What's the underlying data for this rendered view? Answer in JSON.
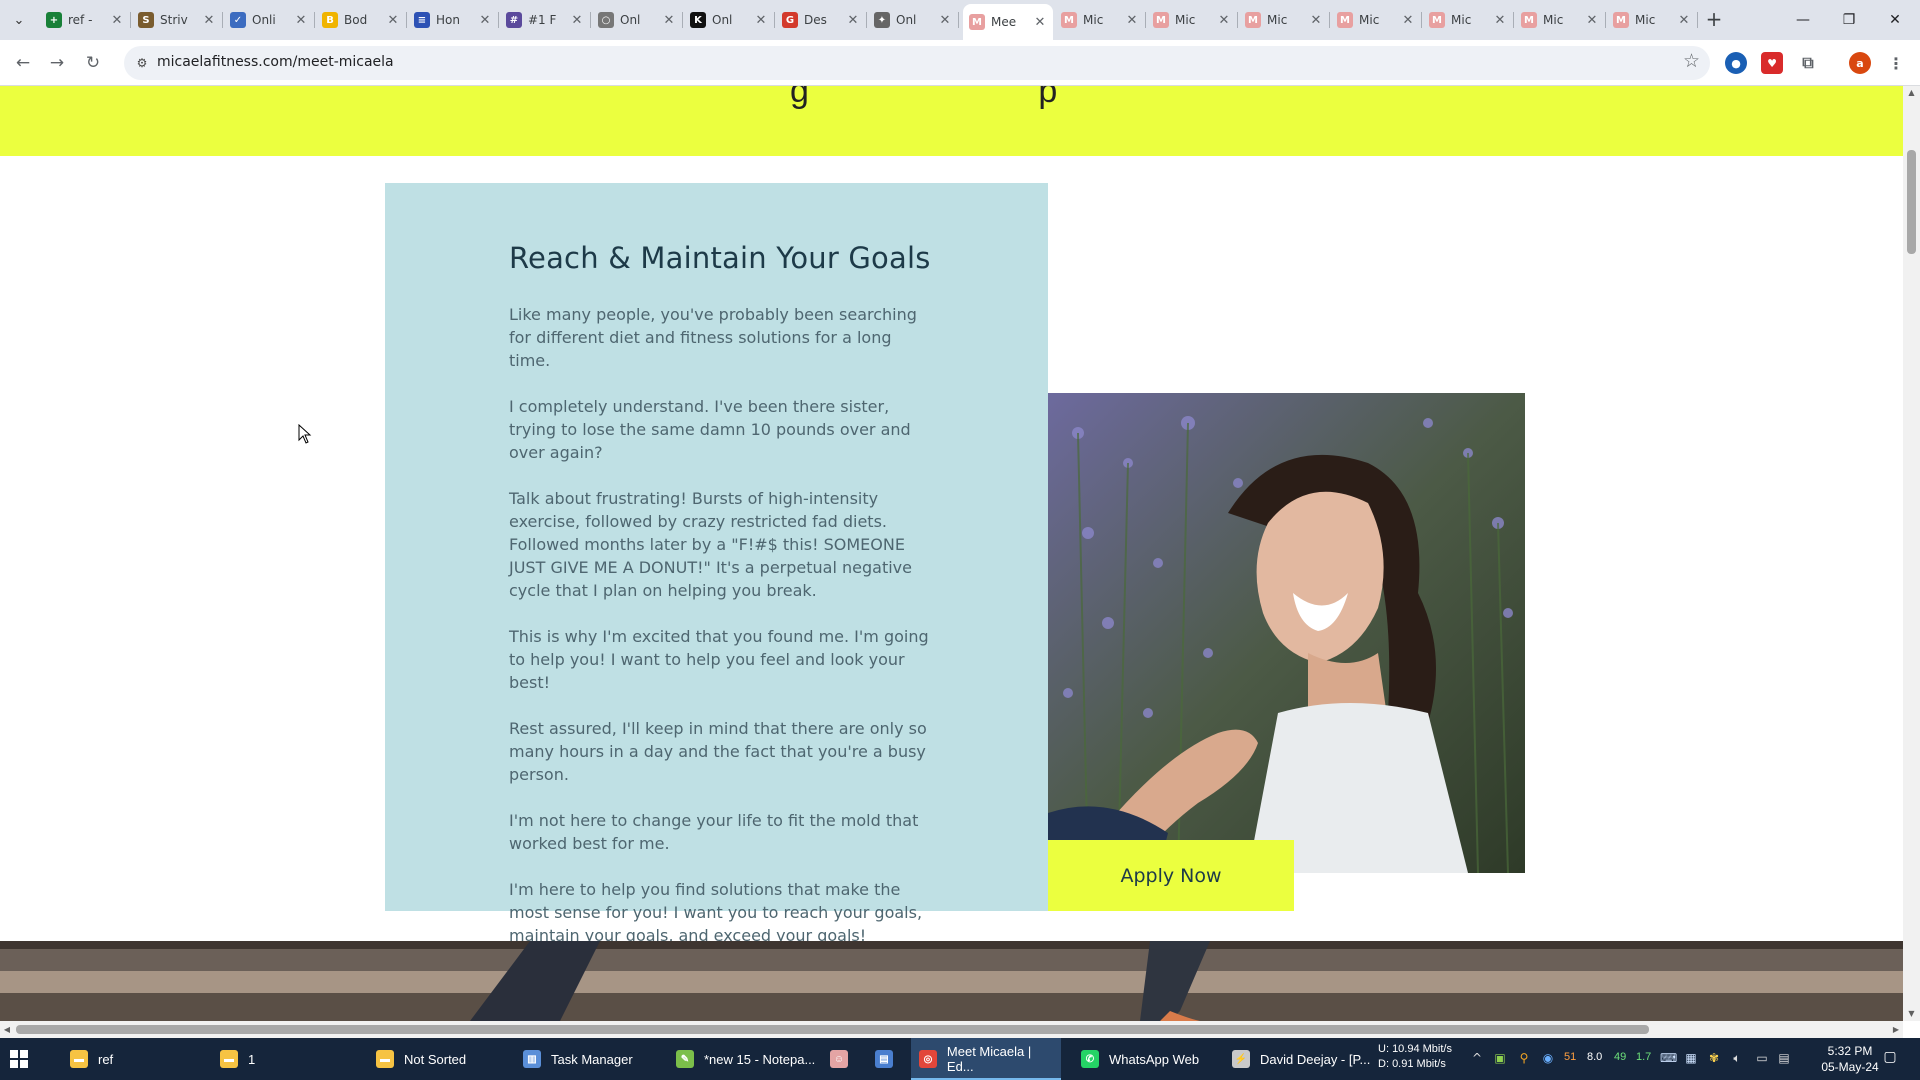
{
  "browser": {
    "tabs": [
      {
        "label": "ref -",
        "icon": "sheets-icon",
        "color": "#188038",
        "glyph": "+"
      },
      {
        "label": "Striv",
        "icon": "striv-icon",
        "color": "#7a5c2e",
        "glyph": "S"
      },
      {
        "label": "Onli",
        "icon": "onli-check-icon",
        "color": "#3c6cc0",
        "glyph": "✓"
      },
      {
        "label": "Bod",
        "icon": "bod-icon",
        "color": "#f0b400",
        "glyph": "B"
      },
      {
        "label": "Hon",
        "icon": "hon-icon",
        "color": "#2d52b5",
        "glyph": "≡"
      },
      {
        "label": "#1 F",
        "icon": "hash-icon",
        "color": "#5b4a9c",
        "glyph": "#"
      },
      {
        "label": "Onl",
        "icon": "onl-globe-icon",
        "color": "#777777",
        "glyph": "○"
      },
      {
        "label": "Onl",
        "icon": "onl-k-icon",
        "color": "#111111",
        "glyph": "K"
      },
      {
        "label": "Des",
        "icon": "des-icon",
        "color": "#d33a2c",
        "glyph": "G"
      },
      {
        "label": "Onl",
        "icon": "onl-run-icon",
        "color": "#666666",
        "glyph": "✦"
      },
      {
        "label": "Mee",
        "icon": "micaela-icon",
        "color": "#e8a0a0",
        "glyph": "M",
        "active": true
      },
      {
        "label": "Mic",
        "icon": "micaela-icon",
        "color": "#e8a0a0",
        "glyph": "M"
      },
      {
        "label": "Mic",
        "icon": "micaela-icon",
        "color": "#e8a0a0",
        "glyph": "M"
      },
      {
        "label": "Mic",
        "icon": "micaela-icon",
        "color": "#e8a0a0",
        "glyph": "M"
      },
      {
        "label": "Mic",
        "icon": "micaela-icon",
        "color": "#e8a0a0",
        "glyph": "M"
      },
      {
        "label": "Mic",
        "icon": "micaela-icon",
        "color": "#e8a0a0",
        "glyph": "M"
      },
      {
        "label": "Mic",
        "icon": "micaela-icon",
        "color": "#e8a0a0",
        "glyph": "M"
      },
      {
        "label": "Mic",
        "icon": "micaela-icon",
        "color": "#e8a0a0",
        "glyph": "M"
      }
    ],
    "url": "micaelafitness.com/meet-micaela",
    "profile_initial": "a"
  },
  "page": {
    "band_glyphs": "g p",
    "bio": {
      "title": "Reach & Maintain Your Goals",
      "paragraphs": [
        "Like many people, you've probably been searching for different diet and fitness solutions for a long time.",
        "I completely understand. I've been there sister, trying to lose the same damn 10 pounds over and over again?",
        "Talk about frustrating! Bursts of high-intensity exercise, followed by crazy restricted fad diets. Followed months later by a \"F!#$ this! SOMEONE JUST GIVE ME A DONUT!\" It's a perpetual negative cycle that I plan on helping you break.",
        "This is why I'm excited that you found me. I'm going to help you! I want to help you feel and look your best!",
        "Rest assured, I'll keep in mind that there are only so many hours in a day and the fact that you're a busy person.",
        "I'm not here to change your life to fit the mold that worked best for me.",
        "I'm here to help you find solutions that make the most sense for you! I want you to reach your goals, maintain your goals, and exceed your goals!"
      ]
    },
    "apply_label": "Apply Now",
    "colors": {
      "accent_yellow": "#ebff3f",
      "card_blue": "#bfe0e4",
      "heading_navy": "#1d3a48"
    }
  },
  "taskbar": {
    "items": [
      {
        "label": "ref",
        "icon": "folder-icon"
      },
      {
        "label": "1",
        "icon": "folder-icon"
      },
      {
        "label": "Not Sorted",
        "icon": "folder-icon"
      },
      {
        "label": "Task Manager",
        "icon": "task-manager-icon"
      },
      {
        "label": "*new 15 - Notepa...",
        "icon": "notepad-plus-icon"
      },
      {
        "label": "Meet Micaela | Ed...",
        "icon": "chrome-icon",
        "active": true
      },
      {
        "label": "WhatsApp Web",
        "icon": "whatsapp-icon"
      },
      {
        "label": "David Deejay - [P...",
        "icon": "winamp-icon"
      }
    ],
    "net": {
      "up_label": "U:",
      "up": "10.94 Mbit/s",
      "down_label": "D:",
      "down": "0.91 Mbit/s"
    },
    "tray_numbers": [
      "51",
      "8.0",
      "49",
      "1.7"
    ],
    "time": "5:32 PM",
    "date": "05-May-24"
  }
}
